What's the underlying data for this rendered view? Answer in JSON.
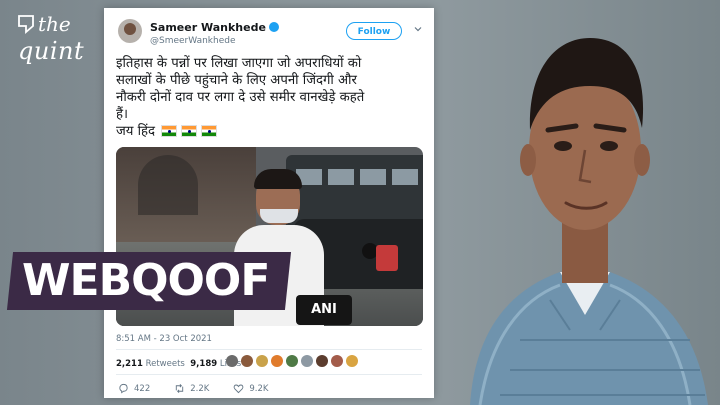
{
  "brand": {
    "logo_line1": "the",
    "logo_line2": "quint"
  },
  "tweet": {
    "author_name": "Sameer Wankhede",
    "author_handle": "@SmeerWankhede",
    "follow_label": "Follow",
    "text_line1": "इतिहास के पन्नों पर लिखा जाएगा जो अपराधियों को",
    "text_line2": "सलाखों के पीछे पहुंचाने के लिए अपनी जिंदगी और",
    "text_line3": "नौकरी दोनों दाव पर लगा दे उसे समीर वानखेड़े कहते",
    "text_line4": "हैं।",
    "text_line5": "जय हिंद",
    "media_caption": "ANI",
    "timestamp": "8:51 AM - 23 Oct 2021",
    "retweets_count": "2,211",
    "retweets_label": "Retweets",
    "likes_count": "9,189",
    "likes_label": "Likes",
    "reply_count": "422",
    "retweet_action_count": "2.2K",
    "like_action_count": "9.2K"
  },
  "overlay": {
    "label": "WEBQOOF"
  },
  "colors": {
    "accent": "#1da1f2",
    "banner": "#3b2a46",
    "background": "#8b969b"
  }
}
